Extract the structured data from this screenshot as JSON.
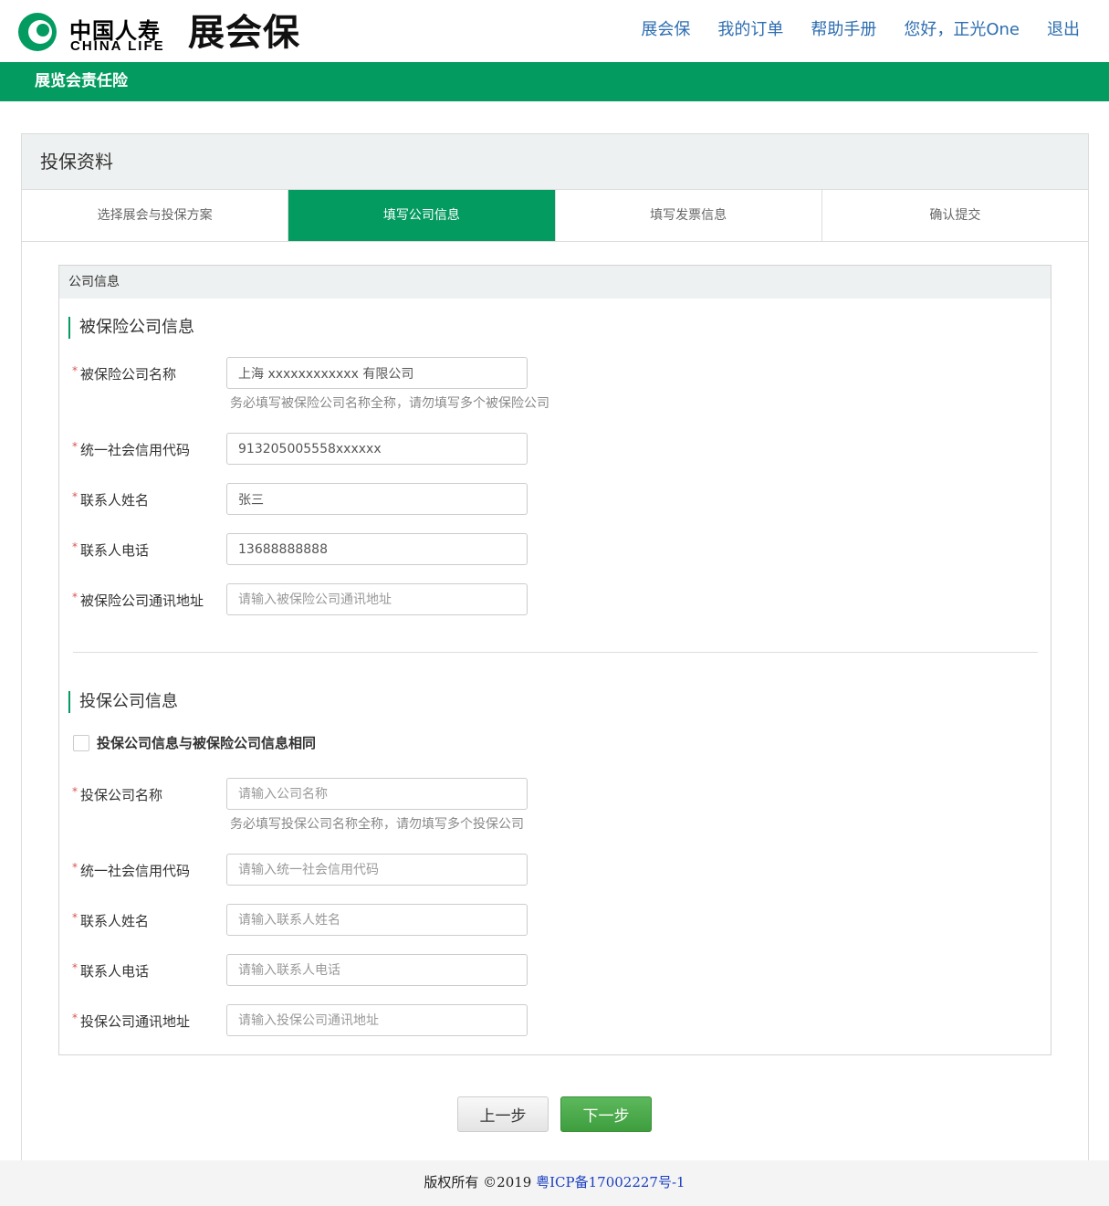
{
  "header": {
    "logo_cn": "中国人寿",
    "logo_en": "CHINA LIFE",
    "brand": "展会保",
    "nav": [
      "展会保",
      "我的订单",
      "帮助手册",
      "您好，正光One",
      "退出"
    ]
  },
  "banner": {
    "title": "展览会责任险"
  },
  "panel": {
    "title": "投保资料",
    "steps": [
      {
        "label": "选择展会与投保方案",
        "active": false
      },
      {
        "label": "填写公司信息",
        "active": true
      },
      {
        "label": "填写发票信息",
        "active": false
      },
      {
        "label": "确认提交",
        "active": false
      }
    ]
  },
  "form": {
    "box_title": "公司信息",
    "insured": {
      "title": "被保险公司信息",
      "fields": [
        {
          "label": "被保险公司名称",
          "value": "上海 xxxxxxxxxxxx 有限公司",
          "placeholder": "",
          "hint": "务必填写被保险公司名称全称，请勿填写多个被保险公司"
        },
        {
          "label": "统一社会信用代码",
          "value": "913205005558xxxxxx",
          "placeholder": ""
        },
        {
          "label": "联系人姓名",
          "value": "张三",
          "placeholder": ""
        },
        {
          "label": "联系人电话",
          "value": "13688888888",
          "placeholder": ""
        },
        {
          "label": "被保险公司通讯地址",
          "value": "",
          "placeholder": "请输入被保险公司通讯地址"
        }
      ]
    },
    "applicant": {
      "title": "投保公司信息",
      "same_as_insured_label": "投保公司信息与被保险公司信息相同",
      "same_as_insured_checked": false,
      "fields": [
        {
          "label": "投保公司名称",
          "value": "",
          "placeholder": "请输入公司名称",
          "hint": "务必填写投保公司名称全称，请勿填写多个投保公司"
        },
        {
          "label": "统一社会信用代码",
          "value": "",
          "placeholder": "请输入统一社会信用代码"
        },
        {
          "label": "联系人姓名",
          "value": "",
          "placeholder": "请输入联系人姓名"
        },
        {
          "label": "联系人电话",
          "value": "",
          "placeholder": "请输入联系人电话"
        },
        {
          "label": "投保公司通讯地址",
          "value": "",
          "placeholder": "请输入投保公司通讯地址"
        }
      ]
    },
    "required_mark": "*"
  },
  "buttons": {
    "prev": "上一步",
    "next": "下一步"
  },
  "footer": {
    "copyright": "版权所有 ©2019 ",
    "icp": "粤ICP备17002227号-1"
  },
  "colors": {
    "brand_green": "#039b5f",
    "link_blue": "#2d6db0",
    "required_red": "#d9534f"
  }
}
